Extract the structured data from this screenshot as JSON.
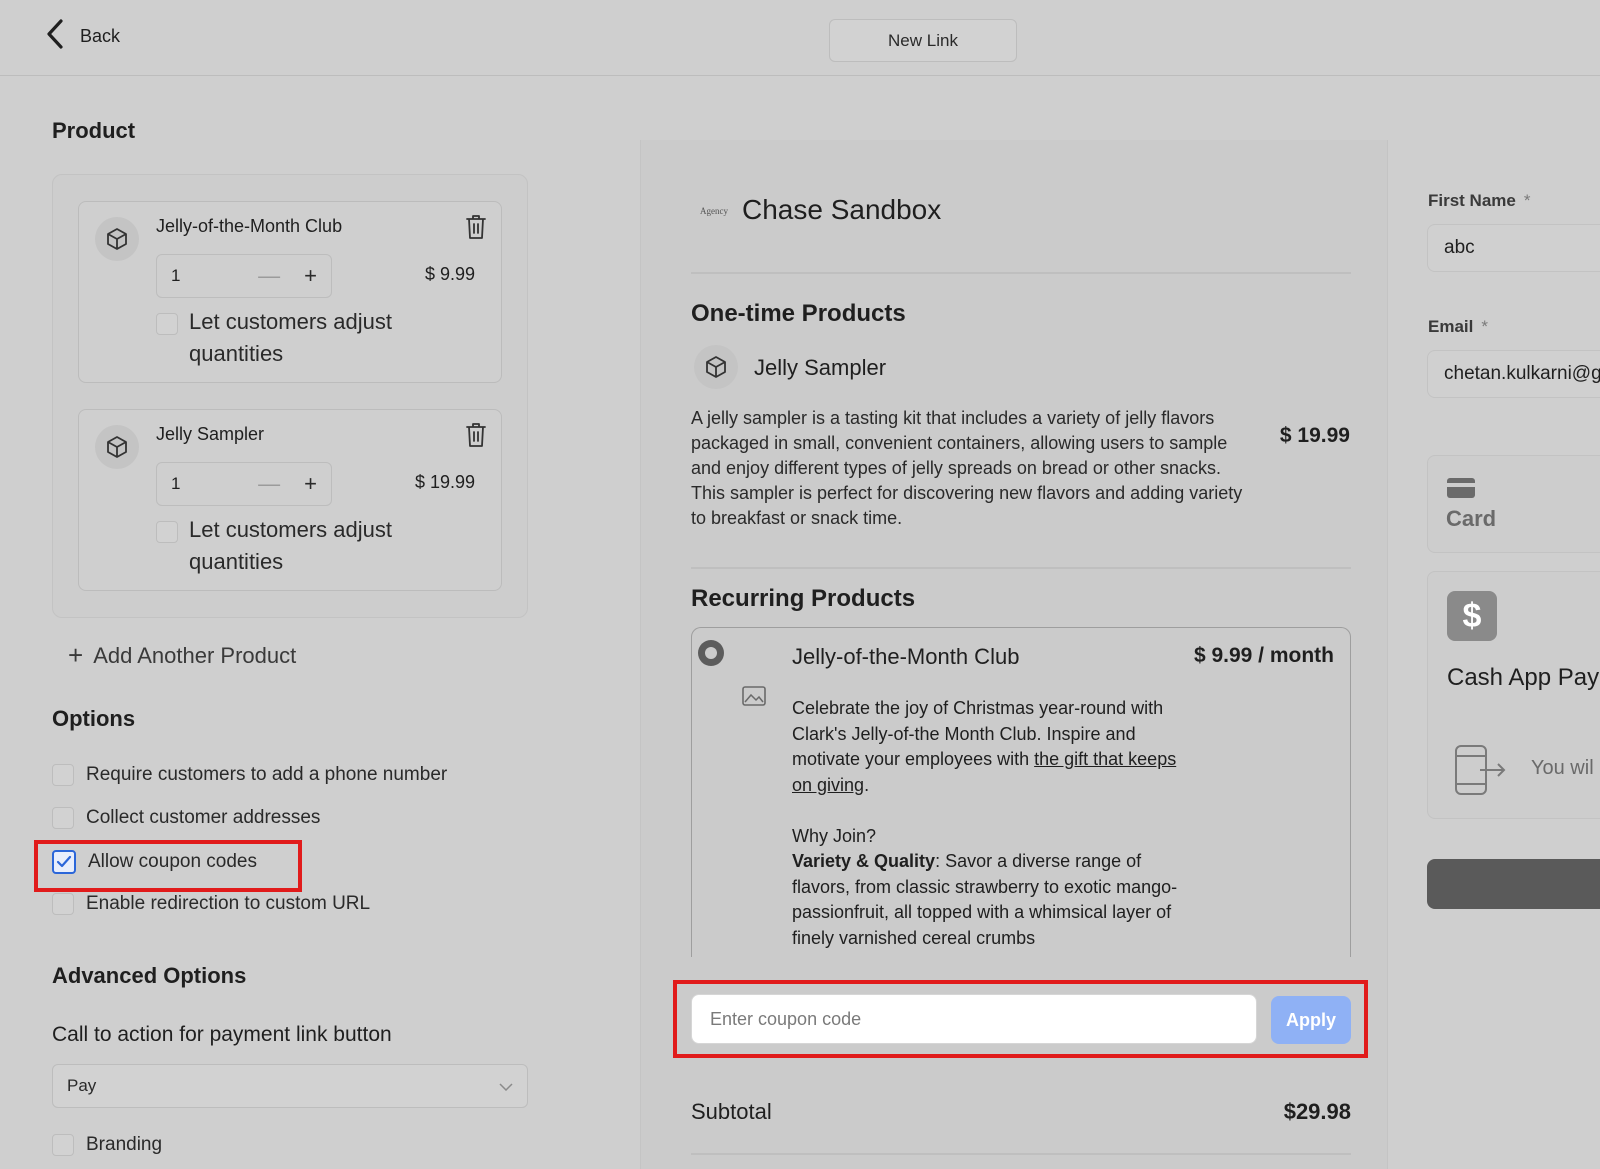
{
  "header": {
    "back_label": "Back",
    "tab_label": "New Link"
  },
  "product_section": {
    "title": "Product",
    "items": [
      {
        "name": "Jelly-of-the-Month Club",
        "quantity": "1",
        "price": "$ 9.99",
        "adjust_label": "Let customers adjust quantities"
      },
      {
        "name": "Jelly Sampler",
        "quantity": "1",
        "price": "$ 19.99",
        "adjust_label": "Let customers adjust quantities"
      }
    ],
    "add_label": "Add Another Product"
  },
  "options": {
    "title": "Options",
    "items": [
      {
        "label": "Require customers to add a phone number",
        "checked": false
      },
      {
        "label": "Collect customer addresses",
        "checked": false
      },
      {
        "label": "Allow coupon codes",
        "checked": true
      },
      {
        "label": "Enable redirection to custom URL",
        "checked": false
      }
    ]
  },
  "advanced": {
    "title": "Advanced Options",
    "cta_label": "Call to action for payment link button",
    "cta_value": "Pay",
    "branding_label": "Branding"
  },
  "preview": {
    "merchant_logo_text": "Agency",
    "merchant_name": "Chase Sandbox",
    "one_time_title": "One-time Products",
    "one_time_product": {
      "name": "Jelly Sampler",
      "description": "A jelly sampler is a tasting kit that includes a variety of jelly flavors packaged in small, convenient containers, allowing users to sample and enjoy different types of jelly spreads on bread or other snacks. This sampler is perfect for discovering new flavors and adding variety to breakfast or snack time.",
      "price": "$ 19.99"
    },
    "recurring_title": "Recurring Products",
    "recurring_product": {
      "name": "Jelly-of-the-Month Club",
      "price": "$ 9.99 / month",
      "desc_part1": "Celebrate the joy of Christmas year-round with Clark's Jelly-of-the Month Club. Inspire and motivate your employees with ",
      "desc_link": "the gift that keeps on giving",
      "desc_part2": ".",
      "why_join": "Why Join?",
      "variety_bold": "Variety & Quality",
      "variety_text": ": Savor a diverse range of flavors, from classic strawberry to exotic mango-passionfruit, all topped with a whimsical layer of finely varnished cereal crumbs"
    },
    "coupon_placeholder": "Enter coupon code",
    "apply_label": "Apply",
    "subtotal_label": "Subtotal",
    "subtotal_value": "$29.98"
  },
  "checkout": {
    "first_name_label": "First Name",
    "first_name_value": "abc",
    "email_label": "Email",
    "email_value": "chetan.kulkarni@g",
    "required_mark": "*",
    "card_label": "Card",
    "cash_app_label": "Cash App Pay",
    "cash_app_note": "You wil"
  },
  "colors": {
    "highlight": "#e11b1b",
    "apply_button": "#8fb1f5",
    "checkbox_accent": "#2b66d9"
  }
}
